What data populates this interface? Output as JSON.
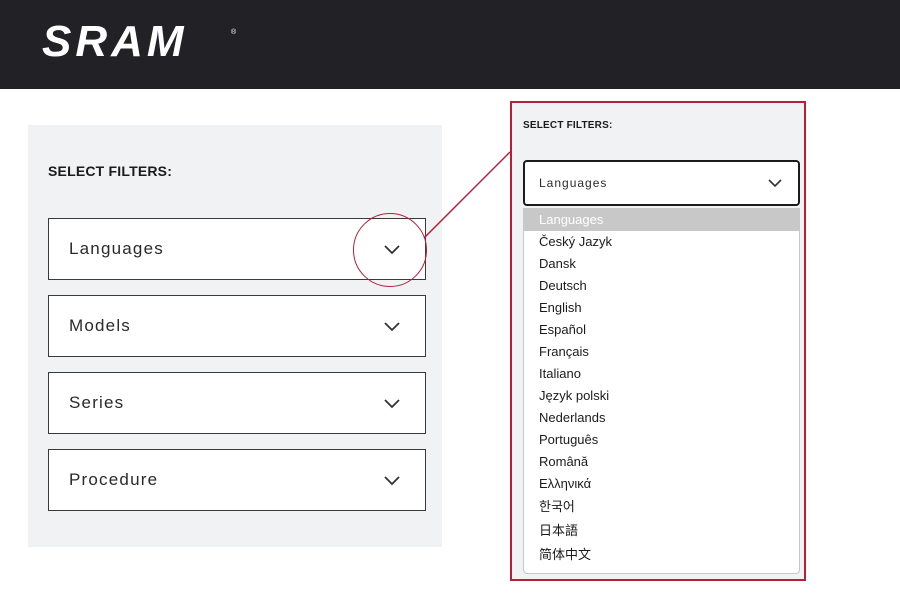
{
  "brand": {
    "logo_text": "SRAM"
  },
  "panel": {
    "title": "SELECT FILTERS:",
    "filters": [
      {
        "label": "Languages"
      },
      {
        "label": "Models"
      },
      {
        "label": "Series"
      },
      {
        "label": "Procedure"
      }
    ]
  },
  "zoom": {
    "title": "SELECT FILTERS:",
    "select_label": "Languages",
    "options": [
      "Languages",
      "Český Jazyk",
      "Dansk",
      "Deutsch",
      "English",
      "Español",
      "Français",
      "Italiano",
      "Język polski",
      "Nederlands",
      "Português",
      "Română",
      "Ελληνικά",
      "한국어",
      "日本語",
      "简体中文"
    ],
    "selected_option": "Languages"
  },
  "colors": {
    "header_bg": "#222226",
    "panel_bg": "#f1f2f4",
    "annotation": "#b51f3a",
    "selected_option_bg": "#c8c8c8"
  },
  "icons": {
    "chevron": "chevron-down-icon"
  }
}
